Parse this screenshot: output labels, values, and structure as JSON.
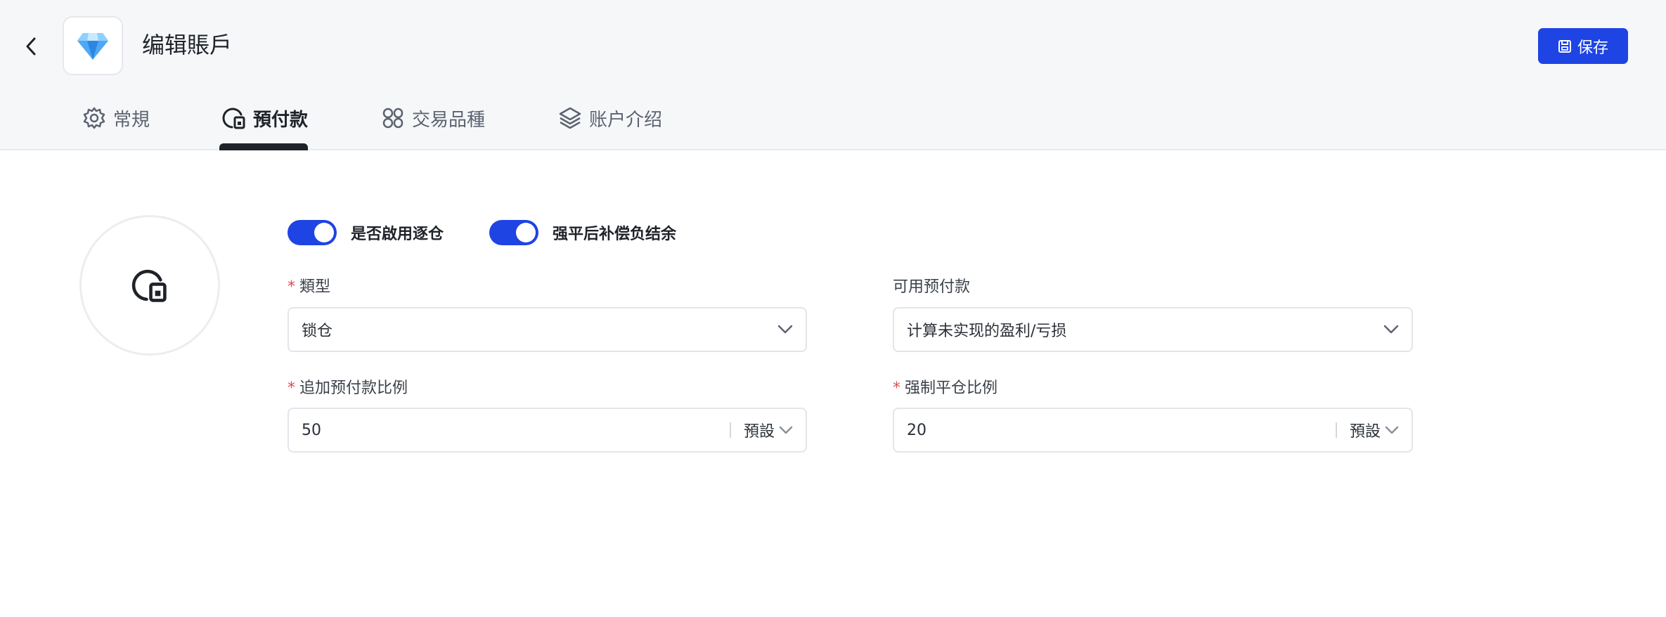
{
  "header": {
    "title": "编辑賬戶",
    "save_label": "保存",
    "logo_icon": "diamond-icon"
  },
  "tabs": [
    {
      "label": "常規",
      "icon": "gear-icon",
      "active": false
    },
    {
      "label": "預付款",
      "icon": "margin-icon",
      "active": true
    },
    {
      "label": "交易品種",
      "icon": "grid-icon",
      "active": false
    },
    {
      "label": "账户介绍",
      "icon": "layers-icon",
      "active": false
    }
  ],
  "toggles": [
    {
      "label": "是否啟用逐仓",
      "on": true
    },
    {
      "label": "强平后补偿负结余",
      "on": true
    }
  ],
  "form": {
    "type": {
      "label": "類型",
      "required": true,
      "value": "锁仓"
    },
    "available_margin": {
      "label": "可用预付款",
      "required": false,
      "value": "计算未实现的盈利/亏损"
    },
    "margin_call_ratio": {
      "label": "追加预付款比例",
      "required": true,
      "value": "50",
      "unit": "預設"
    },
    "stop_out_ratio": {
      "label": "强制平仓比例",
      "required": true,
      "value": "20",
      "unit": "預設"
    }
  },
  "colors": {
    "accent": "#1e44e4",
    "required": "#e5484d",
    "header_bg": "#f6f7f9"
  }
}
